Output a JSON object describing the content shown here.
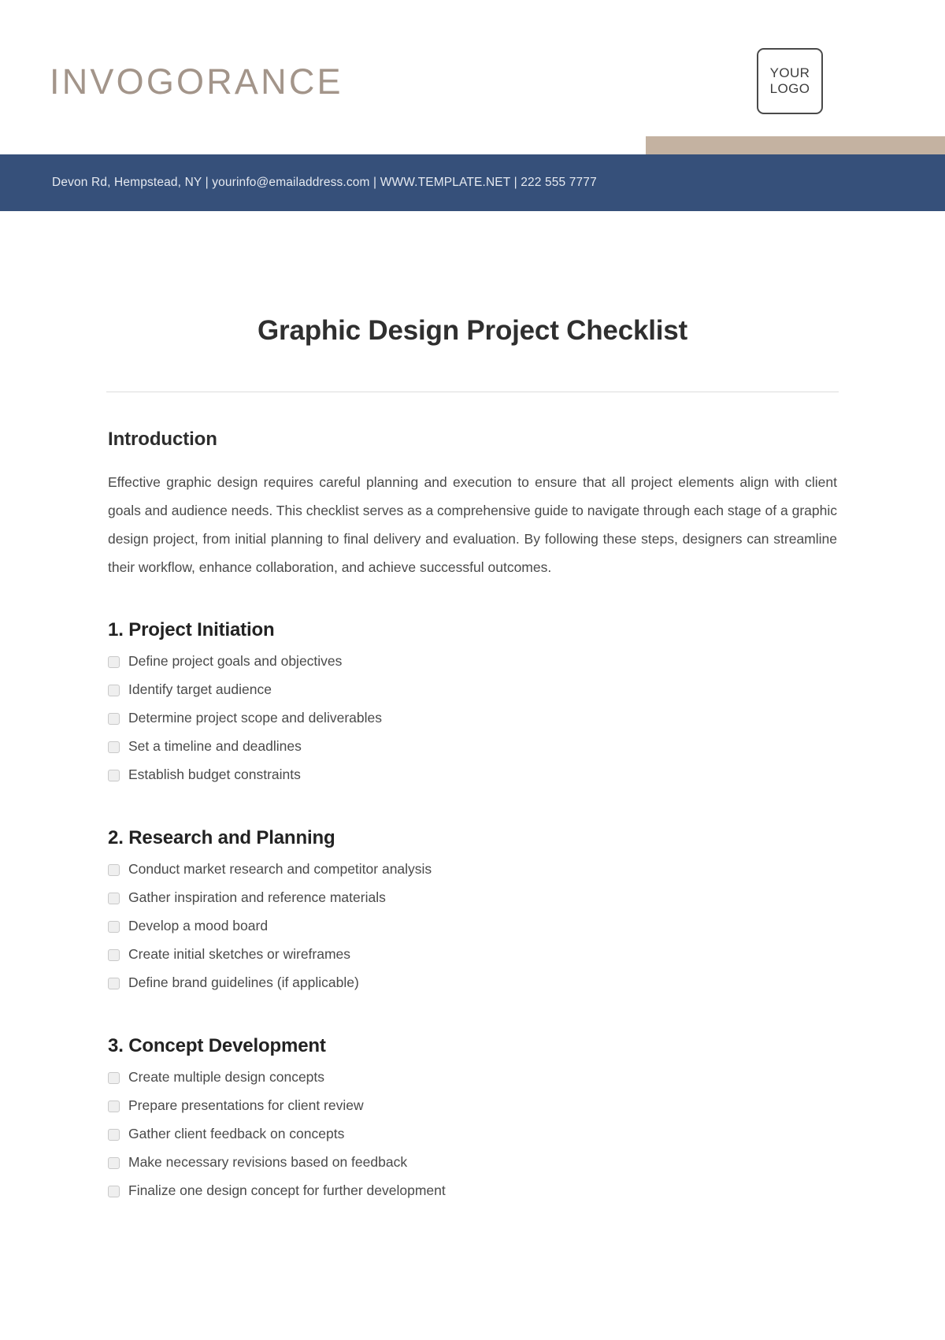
{
  "header": {
    "brand_name": "INVOGORANCE",
    "logo_line1": "YOUR",
    "logo_line2": "LOGO",
    "accent_color": "#c4b2a1",
    "band_color": "#36507a",
    "brand_color": "#a3958a"
  },
  "contact": {
    "line": "Devon Rd, Hempstead, NY | yourinfo@emailaddress.com | WWW.TEMPLATE.NET | 222 555 7777"
  },
  "document": {
    "title": "Graphic Design Project Checklist",
    "intro_heading": "Introduction",
    "intro_paragraph": "Effective graphic design requires careful planning and execution to ensure that all project elements align with client goals and audience needs. This checklist serves as a comprehensive guide to navigate through each stage of a graphic design project, from initial planning to final delivery and evaluation. By following these steps, designers can streamline their workflow, enhance collaboration, and achieve successful outcomes."
  },
  "sections": [
    {
      "heading": "1. Project Initiation",
      "items": [
        "Define project goals and objectives",
        "Identify target audience",
        "Determine project scope and deliverables",
        "Set a timeline and deadlines",
        "Establish budget constraints"
      ]
    },
    {
      "heading": "2. Research and Planning",
      "items": [
        "Conduct market research and competitor analysis",
        "Gather inspiration and reference materials",
        "Develop a mood board",
        "Create initial sketches or wireframes",
        "Define brand guidelines (if applicable)"
      ]
    },
    {
      "heading": "3. Concept Development",
      "items": [
        "Create multiple design concepts",
        "Prepare presentations for client review",
        "Gather client feedback on concepts",
        "Make necessary revisions based on feedback",
        "Finalize one design concept for further development"
      ]
    }
  ]
}
